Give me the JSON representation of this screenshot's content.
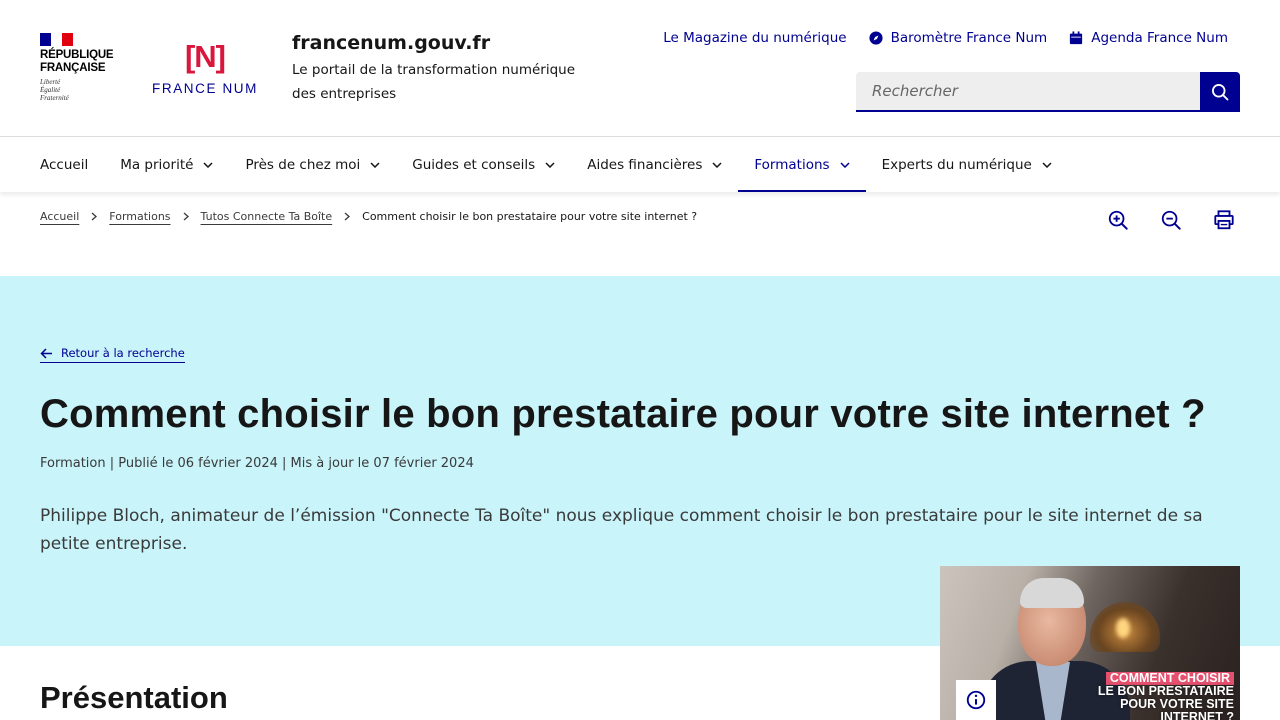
{
  "header": {
    "rf_logo": {
      "line1": "RÉPUBLIQUE",
      "line2": "FRANÇAISE",
      "motto1": "Liberté",
      "motto2": "Égalité",
      "motto3": "Fraternité"
    },
    "fn_logo": {
      "mark": "[N]",
      "text": "FRANCE NUM"
    },
    "site_title": "francenum.gouv.fr",
    "tagline": "Le portail de la transformation numérique des entreprises",
    "quicklinks": [
      {
        "label": "Le Magazine du numérique",
        "icon": "none"
      },
      {
        "label": "Baromètre France Num",
        "icon": "compass-icon"
      },
      {
        "label": "Agenda France Num",
        "icon": "calendar-icon"
      }
    ],
    "search": {
      "placeholder": "Rechercher",
      "button_icon": "search-icon"
    }
  },
  "nav": {
    "items": [
      {
        "label": "Accueil",
        "dropdown": false
      },
      {
        "label": "Ma priorité",
        "dropdown": true
      },
      {
        "label": "Près de chez moi",
        "dropdown": true
      },
      {
        "label": "Guides et conseils",
        "dropdown": true
      },
      {
        "label": "Aides financières",
        "dropdown": true
      },
      {
        "label": "Formations",
        "dropdown": true,
        "active": true
      },
      {
        "label": "Experts du numérique",
        "dropdown": true
      }
    ]
  },
  "breadcrumb": {
    "items": [
      "Accueil",
      "Formations",
      "Tutos Connecte Ta Boîte"
    ],
    "current": "Comment choisir le bon prestataire pour votre site internet ?"
  },
  "tools": [
    "zoom-in-icon",
    "zoom-out-icon",
    "print-icon"
  ],
  "hero": {
    "back_link": "Retour à la recherche",
    "title": "Comment choisir le bon prestataire pour votre site internet ?",
    "meta": "Formation | Publié le 06 février 2024 | Mis à jour le 07 février 2024",
    "lead": "Philippe Bloch, animateur de l’émission \"Connecte Ta Boîte\" nous explique comment choisir le bon prestataire pour le site internet de sa petite entreprise.",
    "background_color": "#c8f4fa"
  },
  "video": {
    "caption_line1": "COMMENT CHOISIR",
    "caption_line2": "LE BON PRESTATAIRE",
    "caption_line3": "POUR VOTRE SITE",
    "caption_line4": "INTERNET ?",
    "info_icon": "info-icon"
  },
  "section": {
    "title": "Présentation"
  },
  "colors": {
    "primary": "#000091",
    "accent": "#d9163c",
    "hero_bg": "#c8f4fa"
  }
}
